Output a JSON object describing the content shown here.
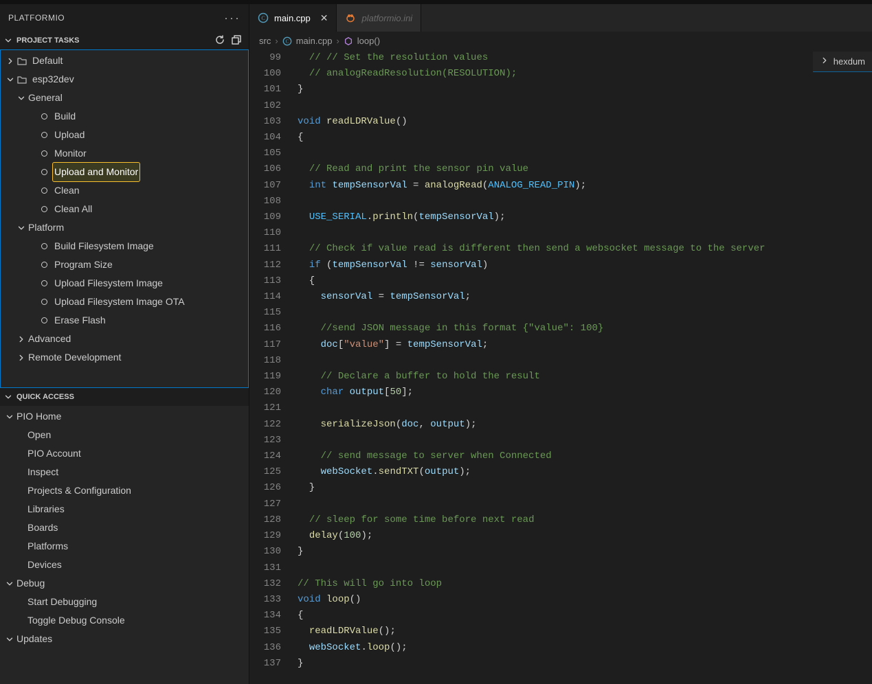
{
  "panel": {
    "title": "PLATFORMIO"
  },
  "sections": {
    "project_tasks": "PROJECT TASKS",
    "quick_access": "QUICK ACCESS"
  },
  "tree": {
    "default": "Default",
    "env": "esp32dev",
    "general": "General",
    "general_items": [
      "Build",
      "Upload",
      "Monitor",
      "Upload and Monitor",
      "Clean",
      "Clean All"
    ],
    "platform": "Platform",
    "platform_items": [
      "Build Filesystem Image",
      "Program Size",
      "Upload Filesystem Image",
      "Upload Filesystem Image OTA",
      "Erase Flash"
    ],
    "advanced": "Advanced",
    "remote": "Remote Development"
  },
  "quick": {
    "pio_home": "PIO Home",
    "pio_home_items": [
      "Open",
      "PIO Account",
      "Inspect",
      "Projects & Configuration",
      "Libraries",
      "Boards",
      "Platforms",
      "Devices"
    ],
    "debug": "Debug",
    "debug_items": [
      "Start Debugging",
      "Toggle Debug Console"
    ],
    "updates": "Updates"
  },
  "tabs": {
    "main": "main.cpp",
    "pio": "platformio.ini"
  },
  "breadcrumb": {
    "p0": "src",
    "p1": "main.cpp",
    "p2": "loop()"
  },
  "overlay": {
    "label": "hexdum"
  },
  "code_start": 99,
  "code": [
    {
      "t": [
        [
          "cm",
          "  // // Set the resolution values"
        ]
      ]
    },
    {
      "t": [
        [
          "pu",
          "  "
        ],
        [
          "cm",
          "// analogReadResolution(RESOLUTION);"
        ]
      ]
    },
    {
      "t": [
        [
          "pu",
          "}"
        ]
      ]
    },
    {
      "t": [
        [
          "pu",
          ""
        ]
      ]
    },
    {
      "t": [
        [
          "kw",
          "void"
        ],
        [
          "pu",
          " "
        ],
        [
          "fn",
          "readLDRValue"
        ],
        [
          "pu",
          "()"
        ]
      ]
    },
    {
      "t": [
        [
          "pu",
          "{"
        ]
      ]
    },
    {
      "t": [
        [
          "pu",
          ""
        ]
      ]
    },
    {
      "t": [
        [
          "pu",
          "  "
        ],
        [
          "cm",
          "// Read and print the sensor pin value"
        ]
      ]
    },
    {
      "t": [
        [
          "pu",
          "  "
        ],
        [
          "kw",
          "int"
        ],
        [
          "pu",
          " "
        ],
        [
          "id",
          "tempSensorVal"
        ],
        [
          "pu",
          " = "
        ],
        [
          "fn",
          "analogRead"
        ],
        [
          "pu",
          "("
        ],
        [
          "co",
          "ANALOG_READ_PIN"
        ],
        [
          "pu",
          ");"
        ]
      ]
    },
    {
      "t": [
        [
          "pu",
          ""
        ]
      ]
    },
    {
      "t": [
        [
          "pu",
          "  "
        ],
        [
          "co",
          "USE_SERIAL"
        ],
        [
          "pu",
          "."
        ],
        [
          "fn",
          "println"
        ],
        [
          "pu",
          "("
        ],
        [
          "id",
          "tempSensorVal"
        ],
        [
          "pu",
          ");"
        ]
      ]
    },
    {
      "t": [
        [
          "pu",
          ""
        ]
      ]
    },
    {
      "t": [
        [
          "pu",
          "  "
        ],
        [
          "cm",
          "// Check if value read is different then send a websocket message to the server"
        ]
      ]
    },
    {
      "t": [
        [
          "pu",
          "  "
        ],
        [
          "kw",
          "if"
        ],
        [
          "pu",
          " ("
        ],
        [
          "id",
          "tempSensorVal"
        ],
        [
          "pu",
          " != "
        ],
        [
          "id",
          "sensorVal"
        ],
        [
          "pu",
          ")"
        ]
      ]
    },
    {
      "t": [
        [
          "pu",
          "  {"
        ]
      ]
    },
    {
      "t": [
        [
          "pu",
          "    "
        ],
        [
          "id",
          "sensorVal"
        ],
        [
          "pu",
          " = "
        ],
        [
          "id",
          "tempSensorVal"
        ],
        [
          "pu",
          ";"
        ]
      ]
    },
    {
      "t": [
        [
          "pu",
          ""
        ]
      ]
    },
    {
      "t": [
        [
          "pu",
          "    "
        ],
        [
          "cm",
          "//send JSON message in this format {\"value\": 100}"
        ]
      ]
    },
    {
      "t": [
        [
          "pu",
          "    "
        ],
        [
          "id",
          "doc"
        ],
        [
          "pu",
          "["
        ],
        [
          "st",
          "\"value\""
        ],
        [
          "pu",
          "] = "
        ],
        [
          "id",
          "tempSensorVal"
        ],
        [
          "pu",
          ";"
        ]
      ]
    },
    {
      "t": [
        [
          "pu",
          ""
        ]
      ]
    },
    {
      "t": [
        [
          "pu",
          "    "
        ],
        [
          "cm",
          "// Declare a buffer to hold the result"
        ]
      ]
    },
    {
      "t": [
        [
          "pu",
          "    "
        ],
        [
          "kw",
          "char"
        ],
        [
          "pu",
          " "
        ],
        [
          "id",
          "output"
        ],
        [
          "pu",
          "["
        ],
        [
          "nu",
          "50"
        ],
        [
          "pu",
          "];"
        ]
      ]
    },
    {
      "t": [
        [
          "pu",
          ""
        ]
      ]
    },
    {
      "t": [
        [
          "pu",
          "    "
        ],
        [
          "fn",
          "serializeJson"
        ],
        [
          "pu",
          "("
        ],
        [
          "id",
          "doc"
        ],
        [
          "pu",
          ", "
        ],
        [
          "id",
          "output"
        ],
        [
          "pu",
          ");"
        ]
      ]
    },
    {
      "t": [
        [
          "pu",
          ""
        ]
      ]
    },
    {
      "t": [
        [
          "pu",
          "    "
        ],
        [
          "cm",
          "// send message to server when Connected"
        ]
      ]
    },
    {
      "t": [
        [
          "pu",
          "    "
        ],
        [
          "id",
          "webSocket"
        ],
        [
          "pu",
          "."
        ],
        [
          "fn",
          "sendTXT"
        ],
        [
          "pu",
          "("
        ],
        [
          "id",
          "output"
        ],
        [
          "pu",
          ");"
        ]
      ]
    },
    {
      "t": [
        [
          "pu",
          "  }"
        ]
      ]
    },
    {
      "t": [
        [
          "pu",
          ""
        ]
      ]
    },
    {
      "t": [
        [
          "pu",
          "  "
        ],
        [
          "cm",
          "// sleep for some time before next read"
        ]
      ]
    },
    {
      "t": [
        [
          "pu",
          "  "
        ],
        [
          "fn",
          "delay"
        ],
        [
          "pu",
          "("
        ],
        [
          "nu",
          "100"
        ],
        [
          "pu",
          ");"
        ]
      ]
    },
    {
      "t": [
        [
          "pu",
          "}"
        ]
      ]
    },
    {
      "t": [
        [
          "pu",
          ""
        ]
      ]
    },
    {
      "t": [
        [
          "cm",
          "// This will go into loop"
        ]
      ]
    },
    {
      "t": [
        [
          "kw",
          "void"
        ],
        [
          "pu",
          " "
        ],
        [
          "fn",
          "loop"
        ],
        [
          "pu",
          "()"
        ]
      ]
    },
    {
      "t": [
        [
          "pu",
          "{"
        ]
      ]
    },
    {
      "t": [
        [
          "pu",
          "  "
        ],
        [
          "fn",
          "readLDRValue"
        ],
        [
          "pu",
          "();"
        ]
      ]
    },
    {
      "t": [
        [
          "pu",
          "  "
        ],
        [
          "id",
          "webSocket"
        ],
        [
          "pu",
          "."
        ],
        [
          "fn",
          "loop"
        ],
        [
          "pu",
          "();"
        ]
      ]
    },
    {
      "t": [
        [
          "pu",
          "}"
        ]
      ]
    }
  ]
}
